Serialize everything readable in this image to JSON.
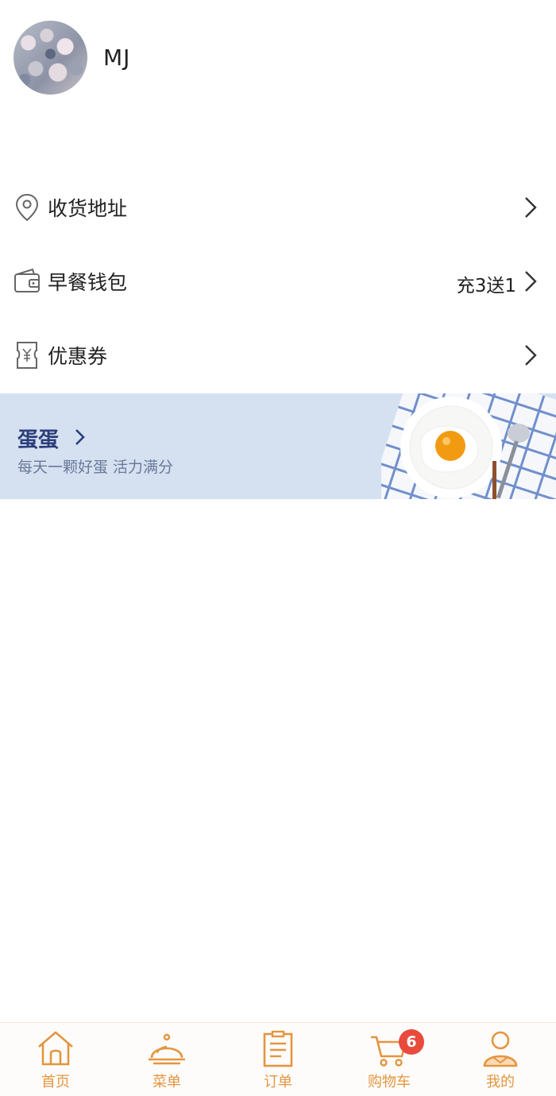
{
  "profile": {
    "username": "MJ"
  },
  "menu": {
    "address": {
      "label": "收货地址"
    },
    "wallet": {
      "label": "早餐钱包",
      "promo": "充3送1"
    },
    "coupon": {
      "label": "优惠券"
    }
  },
  "banner": {
    "title": "蛋蛋",
    "subtitle": "每天一颗好蛋 活力满分"
  },
  "tabs": {
    "home": {
      "label": "首页"
    },
    "menu": {
      "label": "菜单"
    },
    "orders": {
      "label": "订单"
    },
    "cart": {
      "label": "购物车",
      "badge": "6"
    },
    "mine": {
      "label": "我的"
    }
  },
  "colors": {
    "accent": "#e4953f",
    "badge": "#e84b3c",
    "banner_bg": "#d5e0f1",
    "banner_title": "#2b3e7a"
  }
}
